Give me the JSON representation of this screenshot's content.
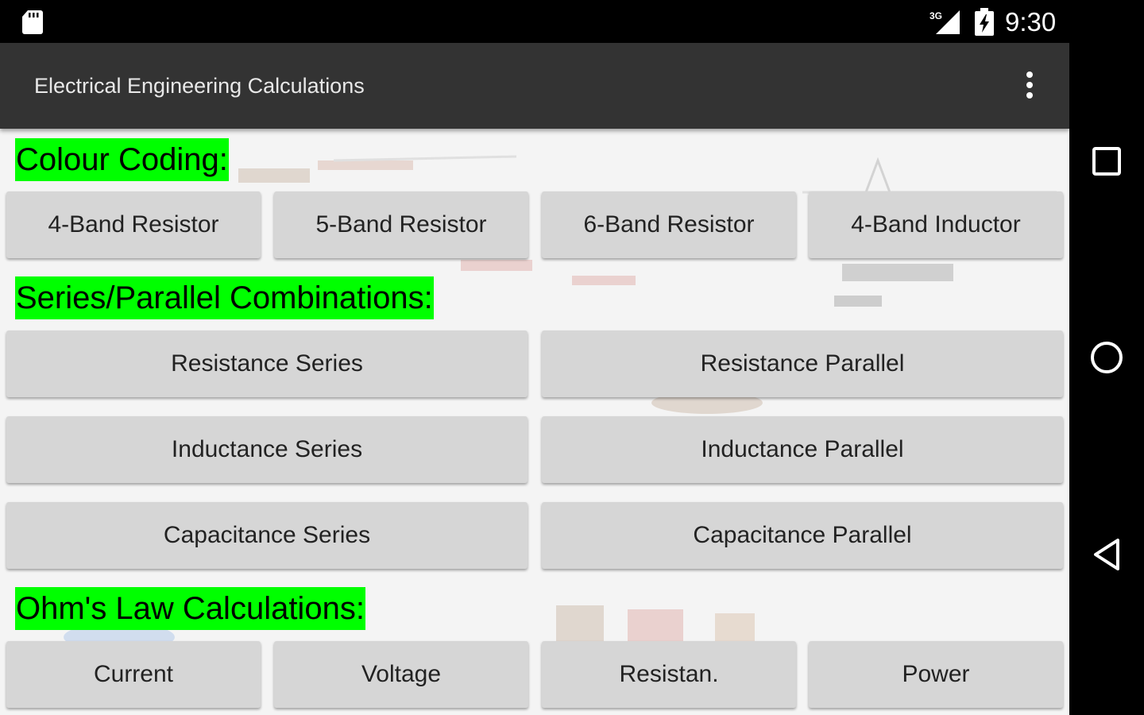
{
  "status_bar": {
    "time": "9:30",
    "network": "3G",
    "icons": [
      "sd-card-icon",
      "signal-icon",
      "battery-charging-icon"
    ]
  },
  "app_bar": {
    "title": "Electrical Engineering Calculations",
    "menu_icon": "more-vertical-icon"
  },
  "sections": {
    "colour_coding": {
      "title": "Colour Coding:",
      "buttons": [
        "4-Band Resistor",
        "5-Band Resistor",
        "6-Band Resistor",
        "4-Band Inductor"
      ]
    },
    "series_parallel": {
      "title": "Series/Parallel Combinations:",
      "buttons": [
        "Resistance Series",
        "Resistance Parallel",
        "Inductance Series",
        "Inductance Parallel",
        "Capacitance Series",
        "Capacitance Parallel"
      ]
    },
    "ohms_law": {
      "title": "Ohm's Law Calculations:",
      "buttons": [
        "Current",
        "Voltage",
        "Resistan.",
        "Power"
      ]
    }
  },
  "nav_bar": {
    "icons": [
      "recents-square-icon",
      "home-circle-icon",
      "back-triangle-icon"
    ]
  },
  "colors": {
    "section_highlight": "#00ff00",
    "app_bar": "#333333",
    "button": "#d6d6d6",
    "background": "#f4f4f4"
  }
}
